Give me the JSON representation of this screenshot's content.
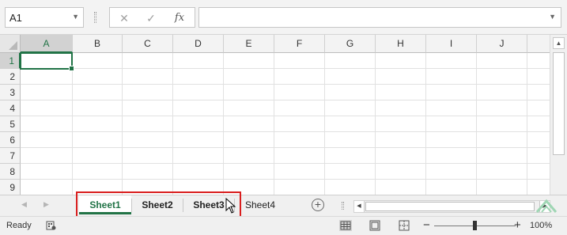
{
  "name_box": {
    "value": "A1"
  },
  "formula_bar": {
    "fx_label": "fx",
    "value": ""
  },
  "columns": [
    "A",
    "B",
    "C",
    "D",
    "E",
    "F",
    "G",
    "H",
    "I",
    "J"
  ],
  "rows": [
    "1",
    "2",
    "3",
    "4",
    "5",
    "6",
    "7",
    "8",
    "9"
  ],
  "selected_cell": "A1",
  "sheet_tabs": [
    {
      "label": "Sheet1",
      "active": true,
      "bold": true
    },
    {
      "label": "Sheet2",
      "active": false,
      "bold": true
    },
    {
      "label": "Sheet3",
      "active": false,
      "bold": true
    },
    {
      "label": "Sheet4",
      "active": false,
      "bold": false
    }
  ],
  "status_bar": {
    "ready": "Ready",
    "zoom": "100%"
  },
  "colors": {
    "excel_green": "#217346",
    "highlight_red": "#d91e1e",
    "grid_line": "#e1e1e1"
  },
  "icons": [
    "chevron-down-icon",
    "cancel-icon",
    "enter-icon",
    "function-icon",
    "add-sheet-icon",
    "mouse-cursor-icon",
    "macro-record-icon",
    "normal-view-icon",
    "page-layout-view-icon",
    "page-break-view-icon",
    "zoom-out-icon",
    "zoom-in-icon"
  ]
}
